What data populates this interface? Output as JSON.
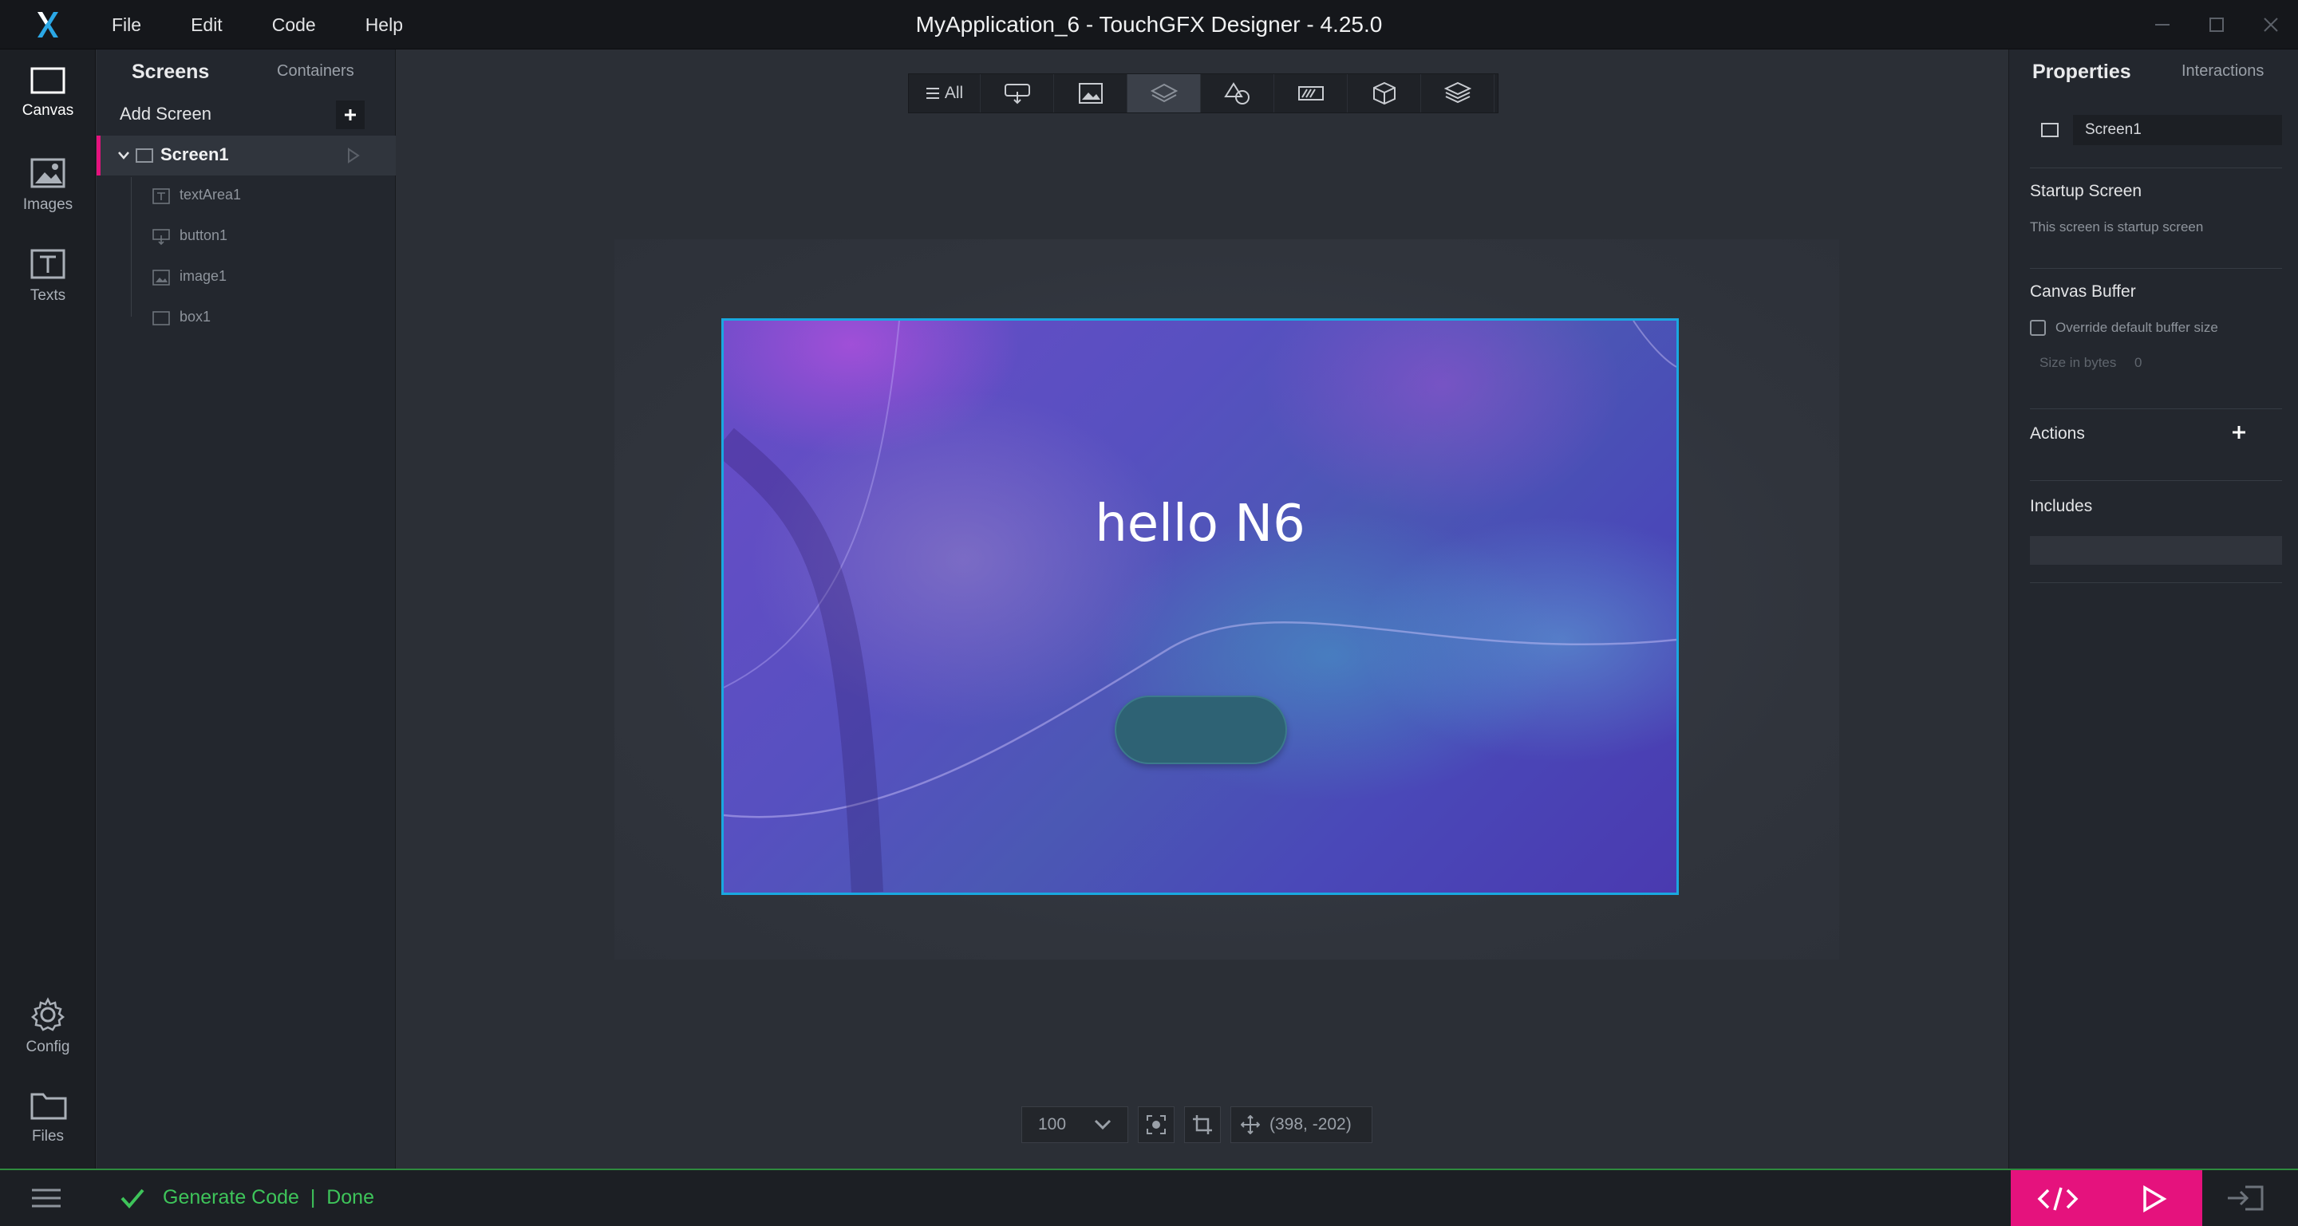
{
  "window": {
    "title": "MyApplication_6 - TouchGFX Designer - 4.25.0",
    "menu": [
      "File",
      "Edit",
      "Code",
      "Help"
    ]
  },
  "rail": {
    "items": [
      {
        "label": "Canvas",
        "icon": "canvas-icon"
      },
      {
        "label": "Images",
        "icon": "image-icon"
      },
      {
        "label": "Texts",
        "icon": "text-icon"
      },
      {
        "label": "Config",
        "icon": "gear-icon"
      },
      {
        "label": "Files",
        "icon": "folder-icon"
      }
    ]
  },
  "screens_panel": {
    "tab_active": "Screens",
    "tab_inactive": "Containers",
    "add_screen": "Add Screen",
    "screen": "Screen1",
    "widgets": [
      "textArea1",
      "button1",
      "image1",
      "box1"
    ]
  },
  "toolbar": {
    "all_label": "All"
  },
  "canvas": {
    "text": "hello N6",
    "zoom": "100",
    "coords": "(398, -202)"
  },
  "properties": {
    "tab_active": "Properties",
    "tab_inactive": "Interactions",
    "name": "Screen1",
    "startup_title": "Startup Screen",
    "startup_desc": "This screen is startup screen",
    "buffer_title": "Canvas Buffer",
    "override_label": "Override default buffer size",
    "size_label": "Size in bytes",
    "size_value": "0",
    "actions_title": "Actions",
    "includes_title": "Includes"
  },
  "status": {
    "text": "Generate Code  |  Done"
  },
  "colors": {
    "accent": "#e5127d",
    "selection": "#1aa8e0",
    "success": "#3ec45a"
  }
}
